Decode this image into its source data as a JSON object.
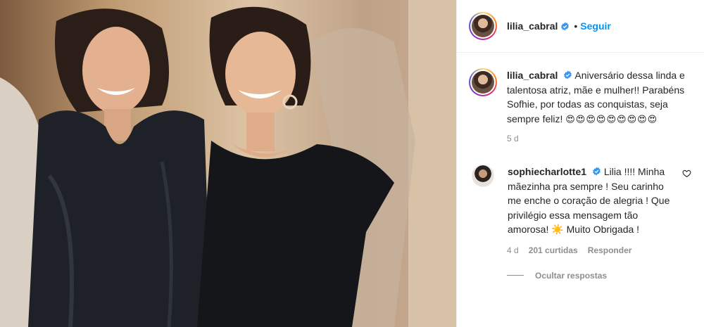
{
  "post": {
    "author": "lilia_cabral",
    "follow_label": "Seguir",
    "dot": "•"
  },
  "caption": {
    "author": "lilia_cabral",
    "text": "Aniversário dessa linda e talentosa atriz, mãe e mulher!! Parabéns Sofhie, por todas as conquistas, seja sempre feliz!",
    "emojis": "😍😍😍😍😍😍😍😍😍",
    "time": "5 d"
  },
  "comment": {
    "author": "sophiecharlotte1",
    "text": "Lilia !!!! Minha mãezinha pra sempre ! Seu carinho me enche o coração de alegria ! Que privilégio essa mensagem tão amorosa! ☀️ Muito Obrigada !",
    "time": "4 d",
    "likes": "201 curtidas",
    "reply_label": "Responder",
    "hide_replies_label": "Ocultar respostas"
  },
  "icons": {
    "verified": "verified-badge-icon",
    "heart": "heart-outline-icon"
  },
  "colors": {
    "link_blue": "#0095f6",
    "verified_blue": "#3897f0",
    "muted": "#8e8e8e"
  }
}
